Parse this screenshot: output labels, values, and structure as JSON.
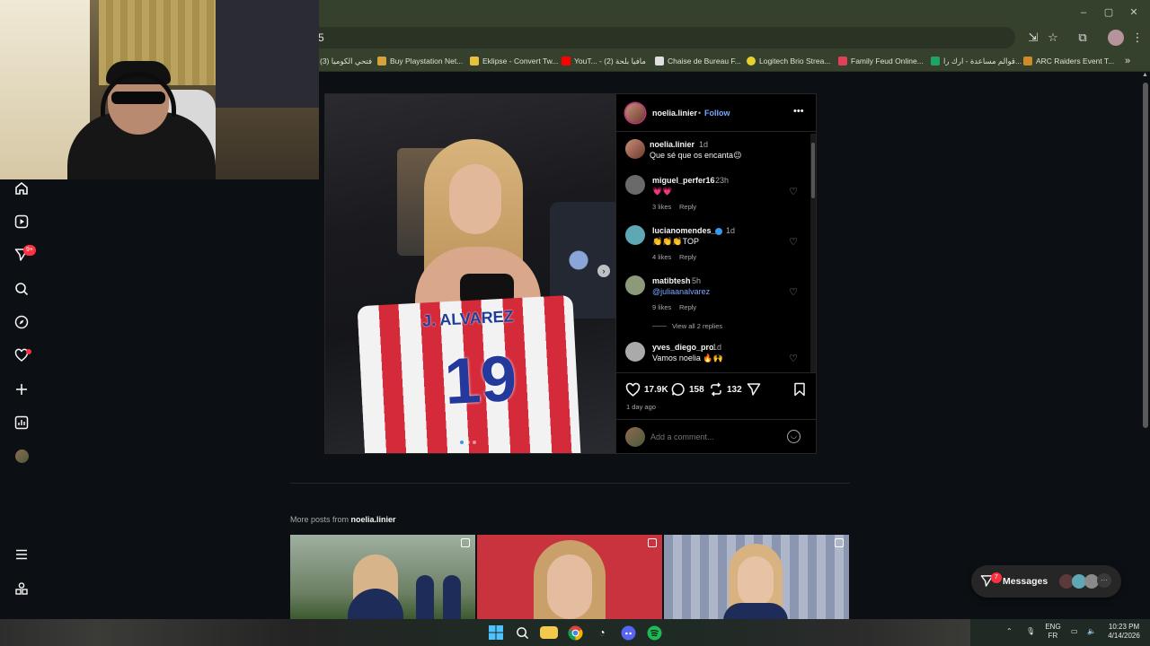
{
  "browser": {
    "address_text": "5",
    "bookmarks": [
      {
        "label": "(3) فتحي الكوميا",
        "icon_color": "#3b5a3a"
      },
      {
        "label": "Buy Playstation Net...",
        "icon_color": "#d8a23a"
      },
      {
        "label": "Eklipse - Convert Tw...",
        "icon_color": "#e5c23a"
      },
      {
        "label": "YouT... - مافيا بلحة (2)",
        "icon_color": "#ff0000"
      },
      {
        "label": "Chaise de Bureau F...",
        "icon_color": "#e0e0e0"
      },
      {
        "label": "Logitech Brio Strea...",
        "icon_color": "#e8d02f"
      },
      {
        "label": "Family Feud Online...",
        "icon_color": "#e0405a"
      },
      {
        "label": "قوالم مساعدة - ارك را...",
        "icon_color": "#1fa463"
      },
      {
        "label": "ARC Raiders Event T...",
        "icon_color": "#d08a2a"
      }
    ],
    "more_bookmarks": "»"
  },
  "sidebar": {
    "items": [
      {
        "icon": "home-icon",
        "glyph": "⌂"
      },
      {
        "icon": "reels-icon",
        "glyph": "▶"
      },
      {
        "icon": "messages-icon",
        "glyph": "➢"
      },
      {
        "icon": "search-icon",
        "glyph": "⌕"
      },
      {
        "icon": "explore-icon",
        "glyph": "◎"
      },
      {
        "icon": "notifications-icon",
        "glyph": "♡"
      },
      {
        "icon": "create-icon",
        "glyph": "+"
      },
      {
        "icon": "dashboard-icon",
        "glyph": "▦"
      }
    ],
    "messages_badge": "9+",
    "more_glyph": "☰",
    "meta_glyph": "⧉"
  },
  "post": {
    "author": "noelia.linier",
    "follow_label": "Follow",
    "more_glyph": "•••",
    "jersey_name": "J. ALVAREZ",
    "jersey_number": "19",
    "caption": {
      "user": "noelia.linier",
      "time": "1d",
      "text": "Que sé que os encanta😉"
    },
    "comments": [
      {
        "user": "miguel_perfer16",
        "time": "23h",
        "text": "💗💗",
        "likes": "3 likes",
        "reply": "Reply",
        "verified": false,
        "avatar": "#6a6a6a"
      },
      {
        "user": "lucianomendes_",
        "time": "1d",
        "text": "👏👏👏TOP",
        "likes": "4 likes",
        "reply": "Reply",
        "verified": true,
        "avatar": "#5fa7b5"
      },
      {
        "user": "matibtesh",
        "time": "5h",
        "text": "@juliaanalvarez",
        "likes": "9 likes",
        "reply": "Reply",
        "verified": false,
        "avatar": "#8c9a7a"
      },
      {
        "user": "yves_diego_pro",
        "time": "1d",
        "text": "Vamos noelia 🔥🙌",
        "likes": "",
        "reply": "",
        "verified": false,
        "avatar": "#aaaaaa"
      }
    ],
    "view_replies": "View all 2 replies",
    "like_count": "17.9K",
    "comment_count": "158",
    "repost_count": "132",
    "posted": "1 day ago",
    "add_comment_placeholder": "Add a comment..."
  },
  "more_posts": {
    "prefix": "More posts from",
    "user": "noelia.linier"
  },
  "messages_button": {
    "label": "Messages",
    "badge": "7",
    "more_glyph": "···"
  },
  "taskbar": {
    "lang_top": "ENG",
    "lang_bottom": "FR",
    "time": "10:23 PM",
    "date": "4/14/2026"
  }
}
